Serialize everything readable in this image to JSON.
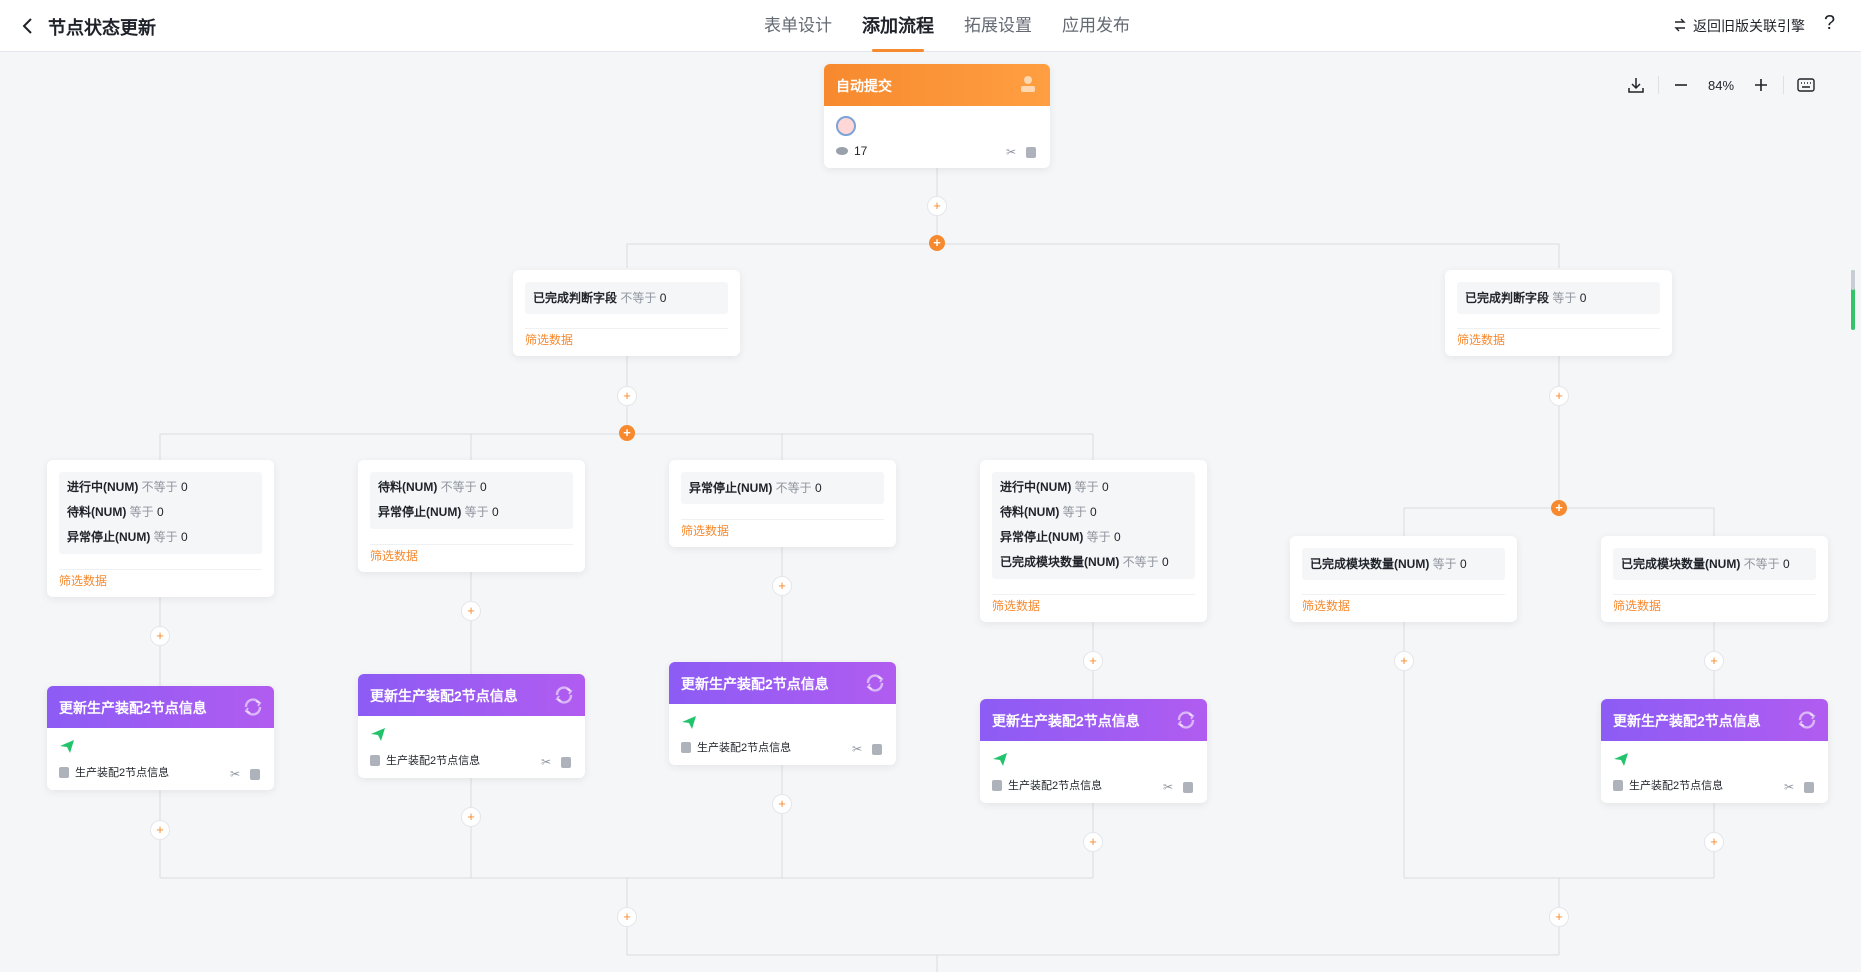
{
  "header": {
    "back_icon": "chevron-left-icon",
    "title": "节点状态更新",
    "tabs": [
      {
        "label": "表单设计",
        "active": false
      },
      {
        "label": "添加流程",
        "active": true
      },
      {
        "label": "拓展设置",
        "active": false
      },
      {
        "label": "应用发布",
        "active": false
      }
    ],
    "revert_icon": "swap-icon",
    "revert_label": "返回旧版关联引擎",
    "help_label": "?"
  },
  "toolbar": {
    "download_icon": "download-icon",
    "zoom_out_icon": "minus-icon",
    "zoom": "84%",
    "zoom_in_icon": "plus-icon",
    "keyboard_icon": "keyboard-icon"
  },
  "colors": {
    "accent": "#f7892e",
    "action_from": "#8c5cf5",
    "action_to": "#b15cf0"
  },
  "start_node": {
    "title": "自动提交",
    "count": "17"
  },
  "plus_symbol": "+",
  "conditions": {
    "c1": {
      "lines": [
        {
          "field": "已完成判断字段",
          "op": "不等于",
          "val": "0"
        }
      ],
      "filter": "筛选数据"
    },
    "c2": {
      "lines": [
        {
          "field": "已完成判断字段",
          "op": "等于",
          "val": "0"
        }
      ],
      "filter": "筛选数据"
    },
    "c3": {
      "lines": [
        {
          "field": "进行中(NUM)",
          "op": "不等于",
          "val": "0"
        },
        {
          "field": "待料(NUM)",
          "op": "等于",
          "val": "0"
        },
        {
          "field": "异常停止(NUM)",
          "op": "等于",
          "val": "0"
        }
      ],
      "filter": "筛选数据"
    },
    "c4": {
      "lines": [
        {
          "field": "待料(NUM)",
          "op": "不等于",
          "val": "0"
        },
        {
          "field": "异常停止(NUM)",
          "op": "等于",
          "val": "0"
        }
      ],
      "filter": "筛选数据"
    },
    "c5": {
      "lines": [
        {
          "field": "异常停止(NUM)",
          "op": "不等于",
          "val": "0"
        }
      ],
      "filter": "筛选数据"
    },
    "c6": {
      "lines": [
        {
          "field": "进行中(NUM)",
          "op": "等于",
          "val": "0"
        },
        {
          "field": "待料(NUM)",
          "op": "等于",
          "val": "0"
        },
        {
          "field": "异常停止(NUM)",
          "op": "等于",
          "val": "0"
        },
        {
          "field": "已完成模块数量(NUM)",
          "op": "不等于",
          "val": "0"
        }
      ],
      "filter": "筛选数据"
    },
    "c7": {
      "lines": [
        {
          "field": "已完成模块数量(NUM)",
          "op": "等于",
          "val": "0"
        }
      ],
      "filter": "筛选数据"
    },
    "c8": {
      "lines": [
        {
          "field": "已完成模块数量(NUM)",
          "op": "不等于",
          "val": "0"
        }
      ],
      "filter": "筛选数据"
    }
  },
  "action": {
    "title": "更新生产装配2节点信息",
    "target": "生产装配2节点信息"
  }
}
